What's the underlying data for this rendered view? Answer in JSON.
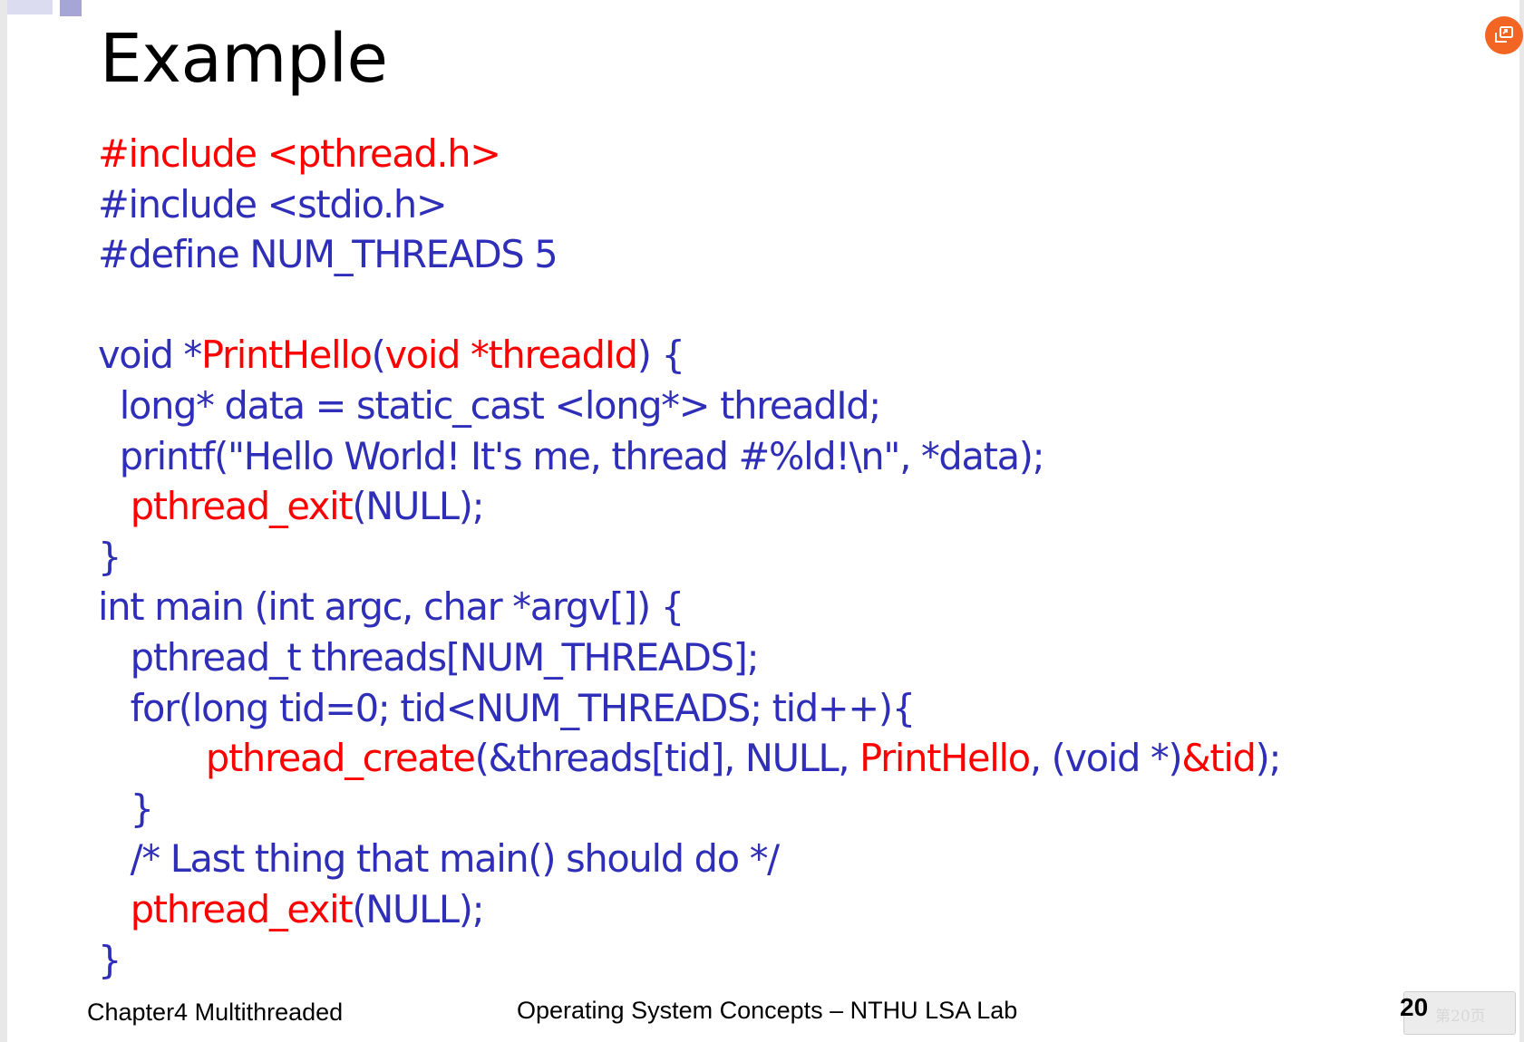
{
  "slide": {
    "title": "Example",
    "code_lines": [
      [
        {
          "t": "#include <pthread.h>",
          "c": "r"
        }
      ],
      [
        {
          "t": "#include <stdio.h>",
          "c": "b"
        }
      ],
      [
        {
          "t": "#define NUM_THREADS 5",
          "c": "b"
        }
      ],
      [
        {
          "t": "",
          "c": "b"
        }
      ],
      [
        {
          "t": "void *",
          "c": "b"
        },
        {
          "t": "PrintHello",
          "c": "r"
        },
        {
          "t": "(",
          "c": "b"
        },
        {
          "t": "void *threadId",
          "c": "r"
        },
        {
          "t": ") {",
          "c": "b"
        }
      ],
      [
        {
          "t": "  long* data = static_cast <long*> threadId;",
          "c": "b"
        }
      ],
      [
        {
          "t": "  printf(\"Hello World! It's me, thread #%ld!\\n\", *data);",
          "c": "b"
        }
      ],
      [
        {
          "t": "   ",
          "c": "b"
        },
        {
          "t": "pthread_exit",
          "c": "r"
        },
        {
          "t": "(NULL);",
          "c": "b"
        }
      ],
      [
        {
          "t": "}",
          "c": "b"
        }
      ],
      [
        {
          "t": "int main (int argc, char *argv[]) {",
          "c": "b"
        }
      ],
      [
        {
          "t": "   pthread_t threads[NUM_THREADS];",
          "c": "b"
        }
      ],
      [
        {
          "t": "   for(long tid=0; tid<NUM_THREADS; tid++){",
          "c": "b"
        }
      ],
      [
        {
          "t": "          ",
          "c": "b"
        },
        {
          "t": "pthread_create",
          "c": "r"
        },
        {
          "t": "(&threads[tid], NULL, ",
          "c": "b"
        },
        {
          "t": "PrintHello",
          "c": "r"
        },
        {
          "t": ", (void *)",
          "c": "b"
        },
        {
          "t": "&tid",
          "c": "r"
        },
        {
          "t": ");",
          "c": "b"
        }
      ],
      [
        {
          "t": "   }",
          "c": "b"
        }
      ],
      [
        {
          "t": "   /* Last thing that main() should do */",
          "c": "b"
        }
      ],
      [
        {
          "t": "   ",
          "c": "b"
        },
        {
          "t": "pthread_exit",
          "c": "r"
        },
        {
          "t": "(NULL);",
          "c": "b"
        }
      ],
      [
        {
          "t": "}",
          "c": "b"
        }
      ]
    ]
  },
  "footer": {
    "chapter": "Chapter4 Multithreaded",
    "course": "Operating System Concepts – NTHU LSA Lab",
    "page_number": "20",
    "page_badge": "第20页"
  },
  "icons": {
    "top_right_button": "share-window-icon"
  },
  "colors": {
    "code_red": "#ff0000",
    "code_blue": "#2e2eb8",
    "accent_orange": "#f26522"
  }
}
